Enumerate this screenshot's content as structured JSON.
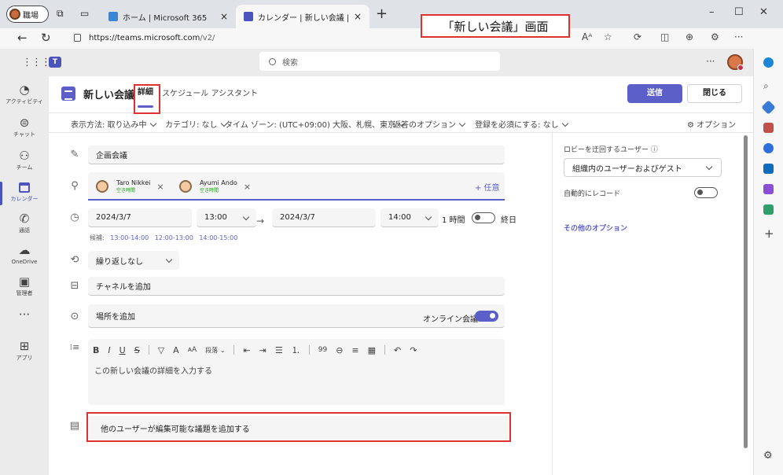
{
  "browser": {
    "profile_label": "職場",
    "tabs": [
      {
        "title": "ホーム | Microsoft 365",
        "close": "×"
      },
      {
        "title": "カレンダー | 新しい会議 | Microsoft",
        "close": "×"
      }
    ],
    "new_tab": "+",
    "window_controls": [
      "–",
      "☐",
      "✕"
    ],
    "url_host": "https://teams.microsoft.com",
    "url_path": "/v2/",
    "address_buttons": [
      "Aᴬ",
      "☆",
      "⟳",
      "◫",
      "⊕",
      "⚙",
      "···"
    ]
  },
  "annotation": {
    "callout": "「新しい会議」画面"
  },
  "teams_header": {
    "search_placeholder": "検索",
    "more": "···"
  },
  "rail": [
    {
      "label": "アクティビティ",
      "icon": "bell-icon",
      "glyph": "🔔"
    },
    {
      "label": "チャット",
      "icon": "chat-icon",
      "glyph": "💬"
    },
    {
      "label": "チーム",
      "icon": "teams-icon",
      "glyph": "👥"
    },
    {
      "label": "カレンダー",
      "icon": "calendar-icon",
      "glyph": ""
    },
    {
      "label": "通話",
      "icon": "phone-icon",
      "glyph": "☏"
    },
    {
      "label": "OneDrive",
      "icon": "cloud-icon",
      "glyph": "☁"
    },
    {
      "label": "管理者",
      "icon": "admin-icon",
      "glyph": "🅰"
    },
    {
      "label": "",
      "icon": "more-icon",
      "glyph": "···"
    },
    {
      "label": "アプリ",
      "icon": "apps-icon",
      "glyph": "⊞"
    }
  ],
  "meeting": {
    "header_title": "新しい会議",
    "tab_details": "詳細",
    "tab_scheduling": "スケジュール アシスタント",
    "send": "送信",
    "close": "閉じる",
    "options": {
      "show_as": "表示方法: 取り込み中",
      "category": "カテゴリ: なし",
      "timezone": "タイム ゾーン: (UTC+09:00) 大阪、札幌、東京",
      "response": "返答のオプション",
      "registration": "登録を必須にする: なし",
      "more_options": "オプション"
    },
    "title_value": "企画会議",
    "attendees": [
      {
        "name": "Taro Nikkei",
        "status": "空き時間"
      },
      {
        "name": "Ayumi Ando",
        "status": "空き時間"
      }
    ],
    "optional_label": "+ 任意",
    "start_date": "2024/3/7",
    "start_time": "13:00",
    "end_date": "2024/3/7",
    "end_time": "14:00",
    "duration": "1 時間",
    "all_day": "終日",
    "suggestions_label": "候補:",
    "suggestions": [
      "13:00-14:00",
      "12:00-13:00",
      "14:00-15:00"
    ],
    "repeat": "繰り返しなし",
    "channel_placeholder": "チャネルを追加",
    "location_placeholder": "場所を追加",
    "online_meeting": "オンライン会議",
    "editor_toolbar": [
      "B",
      "I",
      "U",
      "S",
      "|",
      "▽",
      "A",
      "ᴀA",
      "段落 ⌄",
      "|",
      "⇤",
      "⇥",
      "☰",
      "⒈",
      "|",
      "99",
      "⊖",
      "≡",
      "▦",
      "|",
      "↶",
      "↷"
    ],
    "details_placeholder": "この新しい会議の詳細を入力する",
    "agenda_placeholder": "他のユーザーが編集可能な議題を追加する"
  },
  "right_panel": {
    "lobby_label": "ロビーを迂回するユーザー",
    "lobby_value": "組織内のユーザーおよびゲスト",
    "record_label": "自動的にレコード",
    "record_on": false,
    "more_options_link": "その他のオプション"
  },
  "colors": {
    "accent": "#5b5fc7",
    "annotation_red": "#e03131"
  }
}
